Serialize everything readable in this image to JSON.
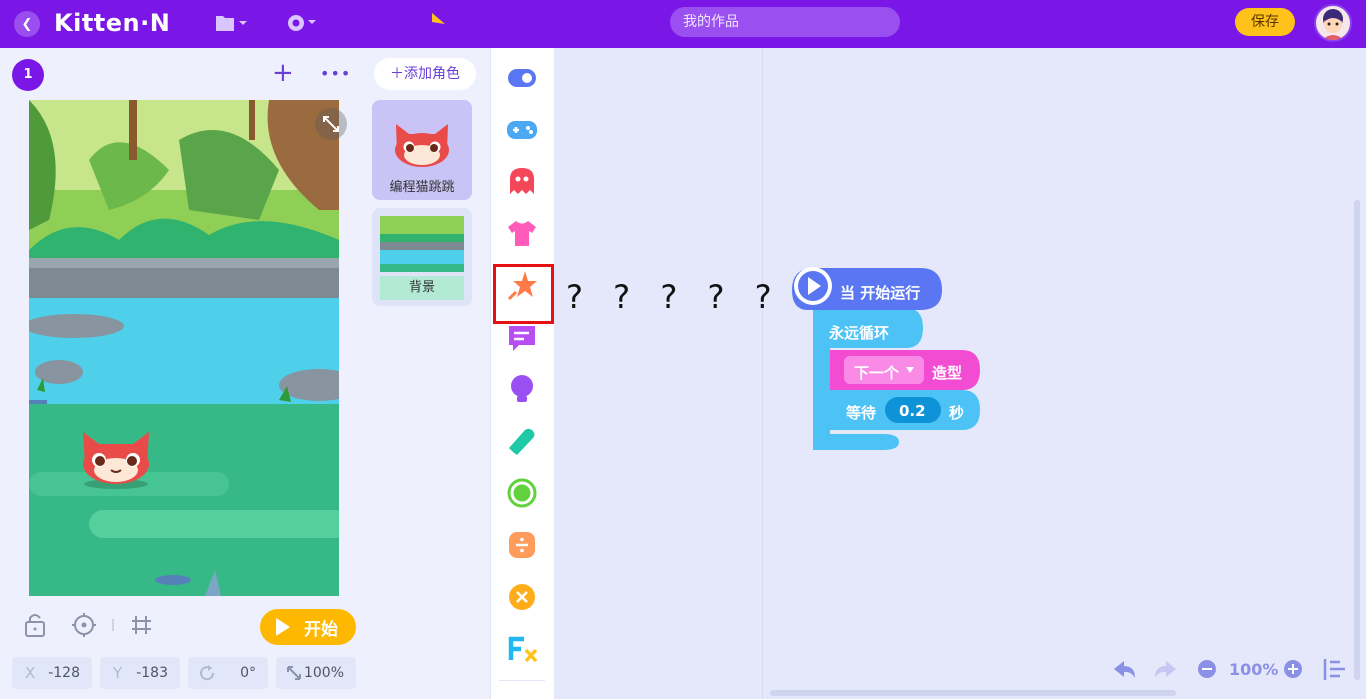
{
  "topbar": {
    "logo": "Kitten·N",
    "project_title": "我的作品",
    "save_label": "保存"
  },
  "stage": {
    "scene_number": "1",
    "start_label": "开始",
    "coords": {
      "x_label": "X",
      "x_value": "-128",
      "y_label": "Y",
      "y_value": "-183",
      "rotation_value": "0°",
      "scale_value": "100%"
    }
  },
  "sprites": {
    "add_label": "＋添加角色",
    "items": [
      {
        "label": "编程猫跳跳"
      },
      {
        "label": "背景"
      }
    ]
  },
  "categories": [
    {
      "icon": "event-icon",
      "color": "#5a76f2"
    },
    {
      "icon": "control-gamepad-icon",
      "color": "#4aa8f5"
    },
    {
      "icon": "ghost-action-icon",
      "color": "#f5475a"
    },
    {
      "icon": "shirt-appearance-icon",
      "color": "#ff5cba"
    },
    {
      "icon": "star-effect-icon",
      "color": "#ff7a47"
    },
    {
      "icon": "chat-icon",
      "color": "#b84df2"
    },
    {
      "icon": "bulb-icon",
      "color": "#9a4ff2"
    },
    {
      "icon": "pen-icon",
      "color": "#1fc9a6"
    },
    {
      "icon": "sensing-circle-icon",
      "color": "#62d13e"
    },
    {
      "icon": "divide-operator-icon",
      "color": "#ff9c5c"
    },
    {
      "icon": "variable-x-icon",
      "color": "#ffac1a"
    },
    {
      "icon": "function-fx-icon",
      "color": "#20b8f2"
    }
  ],
  "flyout": {
    "placeholder": "? ? ? ? ?"
  },
  "blocks": {
    "hat_label": "当 开始运行",
    "loop_label": "永远循环",
    "costume_dropdown": "下一个",
    "costume_label": "造型",
    "wait_label": "等待",
    "wait_value": "0.2",
    "wait_unit": "秒"
  },
  "zoom": {
    "level": "100%"
  },
  "colors": {
    "topbar": "#7a17e6",
    "accent": "#ffb800",
    "event_block": "#5a76f2",
    "control_block": "#4cc2f5",
    "appearance_block": "#f24cd2"
  }
}
